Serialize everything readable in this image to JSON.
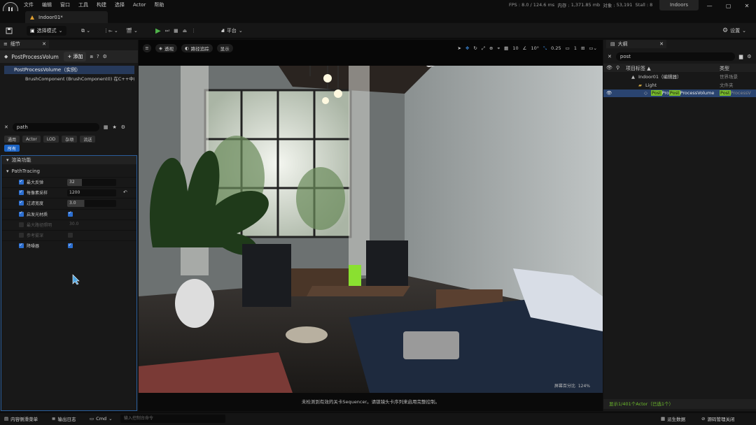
{
  "menu": [
    "文件",
    "编辑",
    "窗口",
    "工具",
    "构建",
    "选择",
    "Actor",
    "帮助"
  ],
  "stats": {
    "fps_label": "FPS :",
    "fps": "8.0",
    "ms": "/ 124.6 ms",
    "mem_label": "内存 :",
    "mem": "1,371.85 mb",
    "objects_label": "对象 :",
    "objects": "53,191",
    "stalls_label": "Stall :",
    "stalls": "8"
  },
  "project_name": "Indoors",
  "window_controls": [
    "—",
    "▢",
    "✕"
  ],
  "doc_tab": {
    "label": "Indoor01*"
  },
  "toolbar": {
    "save_icon": "save-icon",
    "mode": "选择模式",
    "platform": "平台",
    "settings": "设置"
  },
  "details": {
    "tab_title": "细节",
    "actor_name": "PostProcessVolum",
    "add_label": "+ 添加",
    "components": [
      {
        "label": "PostProcessVolume（实例）",
        "selected": true
      },
      {
        "label": "BrushComponent (BrushComponent0)  在C++中编辑",
        "selected": false
      }
    ],
    "search": "path",
    "filters": [
      {
        "label": "通用",
        "on": false
      },
      {
        "label": "Actor",
        "on": false
      },
      {
        "label": "LOD",
        "on": false
      },
      {
        "label": "杂项",
        "on": false
      },
      {
        "label": "流送",
        "on": false
      },
      {
        "label": "所有",
        "on": true
      }
    ],
    "category": "渲染功能",
    "subcategory": "PathTracing",
    "properties": [
      {
        "name": "最大反弹",
        "checked": true,
        "type": "slider",
        "value": "32",
        "fill": 0.3,
        "dim": false
      },
      {
        "name": "每像素采样",
        "checked": true,
        "type": "input",
        "value": "1200",
        "reset": true,
        "dim": false
      },
      {
        "name": "过滤宽度",
        "checked": true,
        "type": "slider",
        "value": "3.0",
        "fill": 0.35,
        "dim": false
      },
      {
        "name": "启发光材质",
        "checked": true,
        "type": "check",
        "value_checked": true,
        "dim": false
      },
      {
        "name": "最大路径照明",
        "checked": false,
        "type": "text",
        "value": "30.0",
        "dim": true
      },
      {
        "name": "参考雾深",
        "checked": false,
        "type": "check",
        "value_checked": false,
        "dim": true
      },
      {
        "name": "降噪器",
        "checked": true,
        "type": "check",
        "value_checked": true,
        "dim": false
      }
    ]
  },
  "viewport": {
    "buttons": [
      "透视",
      "路径追踪",
      "显示"
    ],
    "snap_grid": "10",
    "snap_rot": "10°",
    "snap_scale": "0.25",
    "cam_speed": "1",
    "screen_pct_label": "屏幕百分比",
    "screen_pct": "124%",
    "message": "未检测到有效的关卡Sequencer。请锁镜头卡序列来启用完整控制。"
  },
  "outliner": {
    "tab_title": "大纲",
    "search": "post",
    "col_label": "项目标签 ▲",
    "col_type": "类型",
    "rows": [
      {
        "indent": 40,
        "icon": "world",
        "label": "Indoor01（编辑器）",
        "type": "世界场景",
        "selected": false
      },
      {
        "indent": 50,
        "icon": "folder",
        "label": "Light",
        "type": "文件夹",
        "selected": false
      },
      {
        "indent": 58,
        "icon": "actor",
        "label_parts": [
          "Post",
          "Pro",
          "Post",
          "ProcessVolume"
        ],
        "type_parts": [
          "Post",
          "ProcessV"
        ],
        "selected": true
      }
    ],
    "status": "显示1/401个Actor（已选1个）"
  },
  "statusbar": {
    "drawer": "内容侧滑菜单",
    "output": "输出日志",
    "cmd": "Cmd",
    "cmd_placeholder": "输入控制台命令",
    "derived": "派生数据",
    "source": "源码管理关闭"
  }
}
